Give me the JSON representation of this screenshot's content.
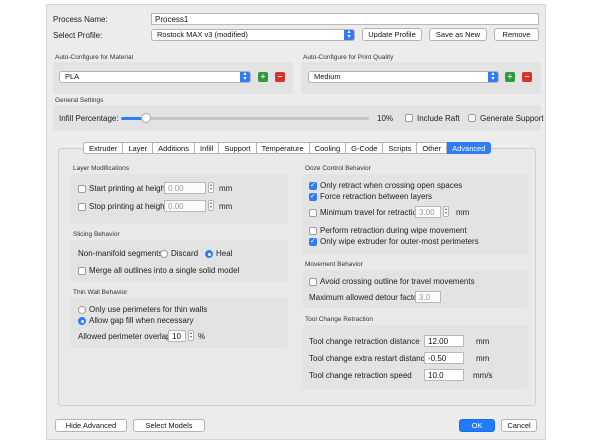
{
  "process": {
    "name_label": "Process Name:",
    "name_value": "Process1",
    "profile_label": "Select Profile:",
    "profile_value": "Rostock MAX v3 (modified)",
    "update_profile": "Update Profile",
    "save_as_new": "Save as New",
    "remove": "Remove"
  },
  "material": {
    "header": "Auto-Configure for Material",
    "value": "PLA"
  },
  "quality": {
    "header": "Auto-Configure for Print Quality",
    "value": "Medium"
  },
  "general": {
    "header": "General Settings",
    "infill_label": "Infill Percentage:",
    "infill_value": "10%",
    "infill_fraction": 0.1,
    "include_raft": "Include Raft",
    "generate_support": "Generate Support"
  },
  "tabs": [
    "Extruder",
    "Layer",
    "Additions",
    "Infill",
    "Support",
    "Temperature",
    "Cooling",
    "G-Code",
    "Scripts",
    "Other",
    "Advanced"
  ],
  "active_tab": "Advanced",
  "layer_mod": {
    "header": "Layer Modifications",
    "start_label": "Start printing at height",
    "start_value": "0.00",
    "start_unit": "mm",
    "stop_label": "Stop printing at height",
    "stop_value": "0.00",
    "stop_unit": "mm"
  },
  "slicing": {
    "header": "Slicing Behavior",
    "nonmanifold_label": "Non-manifold segments:",
    "discard": "Discard",
    "heal": "Heal",
    "merge": "Merge all outlines into a single solid model"
  },
  "thin_wall": {
    "header": "Thin Wall Behavior",
    "only_perimeters": "Only use perimeters for thin walls",
    "allow_gap": "Allow gap fill when necessary",
    "overlap_label": "Allowed perimeter overlap",
    "overlap_value": "10",
    "overlap_unit": "%"
  },
  "ooze": {
    "header": "Ooze Control Behavior",
    "only_retract": "Only retract when crossing open spaces",
    "force_retract": "Force retraction between layers",
    "min_travel_label": "Minimum travel for retraction",
    "min_travel_value": "3.00",
    "min_travel_unit": "mm",
    "perform_wipe": "Perform retraction during wipe movement",
    "only_wipe": "Only wipe extruder for outer-most perimeters"
  },
  "movement": {
    "header": "Movement Behavior",
    "avoid_crossing": "Avoid crossing outline for travel movements",
    "max_detour_label": "Maximum allowed detour factor",
    "max_detour_value": "3.0"
  },
  "toolchange": {
    "header": "Tool Change Retraction",
    "dist_label": "Tool change retraction distance",
    "dist_value": "12.00",
    "dist_unit": "mm",
    "extra_label": "Tool change extra restart distance",
    "extra_value": "-0.50",
    "extra_unit": "mm",
    "speed_label": "Tool change retraction speed",
    "speed_value": "10.0",
    "speed_unit": "mm/s"
  },
  "footer": {
    "hide_advanced": "Hide Advanced",
    "select_models": "Select Models",
    "ok": "OK",
    "cancel": "Cancel"
  },
  "colors": {
    "accent": "#2f7cf6",
    "add": "#2f9a3c",
    "remove": "#d9312b"
  }
}
